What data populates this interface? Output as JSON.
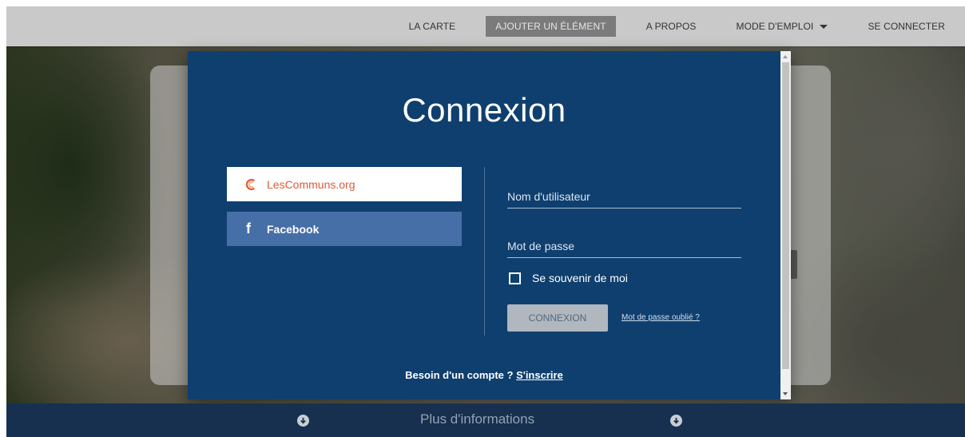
{
  "nav": {
    "items": [
      {
        "label": "LA CARTE"
      },
      {
        "label": "AJOUTER UN ÉLÉMENT"
      },
      {
        "label": "A PROPOS"
      },
      {
        "label": "MODE D'EMPLOI"
      },
      {
        "label": "SE CONNECTER"
      }
    ]
  },
  "modal": {
    "title": "Connexion",
    "providers": {
      "lescommuns": "LesCommuns.org",
      "facebook": "Facebook"
    },
    "form": {
      "username_placeholder": "Nom d'utilisateur",
      "username_value": "",
      "password_placeholder": "Mot de passe",
      "password_value": "",
      "remember_label": "Se souvenir de moi",
      "submit_label": "CONNEXION",
      "forgot_label": "Mot de passe oublié ?"
    },
    "signup_prompt": "Besoin d'un compte ?",
    "signup_link": "S'inscrire"
  },
  "footer": {
    "more_info": "Plus d'informations"
  },
  "colors": {
    "modal_bg": "#0f3f6e",
    "facebook": "#476fa7",
    "lescommuns_accent": "#e05a36",
    "nav_active": "#7b7b7b"
  }
}
